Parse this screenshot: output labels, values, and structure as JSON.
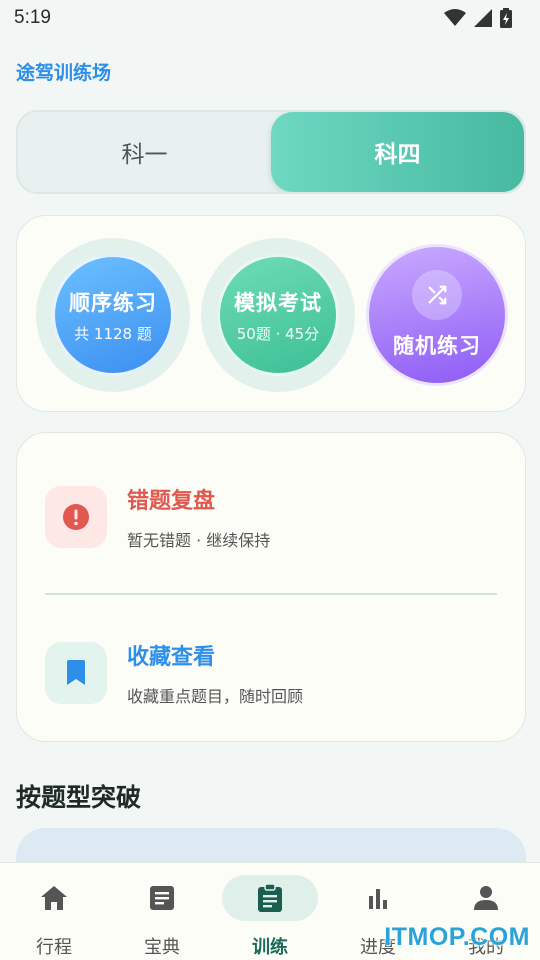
{
  "status_bar": {
    "time": "5:19"
  },
  "app_title": "途驾训练场",
  "subject_tabs": [
    {
      "label": "科一",
      "active": false
    },
    {
      "label": "科四",
      "active": true
    }
  ],
  "practice": {
    "sequential": {
      "title": "顺序练习",
      "subtitle": "共 1128 题"
    },
    "mock_exam": {
      "title": "模拟考试",
      "subtitle": "50题 · 45分"
    },
    "random": {
      "title": "随机练习",
      "icon": "shuffle-icon"
    }
  },
  "review": {
    "mistakes": {
      "title": "错题复盘",
      "subtitle": "暂无错题 · 继续保持",
      "icon": "alert-icon",
      "color": "#e0584f"
    },
    "favorites": {
      "title": "收藏查看",
      "subtitle": "收藏重点题目，随时回顾",
      "icon": "bookmark-icon",
      "color": "#2f8fe8"
    }
  },
  "section_title": "按题型突破",
  "nav": [
    {
      "label": "行程",
      "icon": "home-icon",
      "active": false
    },
    {
      "label": "宝典",
      "icon": "document-icon",
      "active": false
    },
    {
      "label": "训练",
      "icon": "clipboard-icon",
      "active": true
    },
    {
      "label": "进度",
      "icon": "bar-chart-icon",
      "active": false
    },
    {
      "label": "我的",
      "icon": "person-icon",
      "active": false
    }
  ],
  "watermark": "ITMOP.COM",
  "colors": {
    "accent": "#46b9a0",
    "title_blue": "#2f8fe8",
    "error_red": "#e0584f"
  }
}
